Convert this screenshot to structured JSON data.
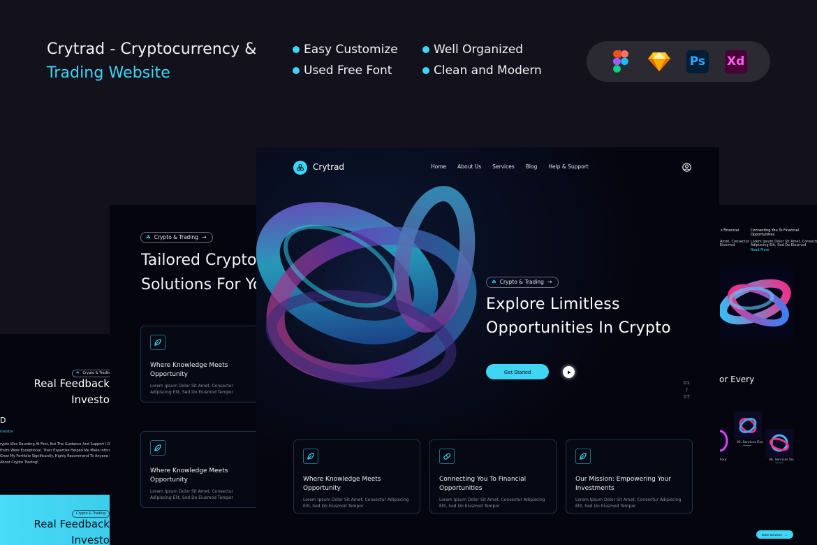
{
  "promo": {
    "title_line1": "Crytrad - Cryptocurrency &",
    "title_line2": "Trading Website",
    "features": [
      "Easy Customize",
      "Well Organized",
      "Used Free Font",
      "Clean and Modern"
    ],
    "tools": [
      "figma",
      "sketch",
      "Ps",
      "Xd"
    ],
    "accent_color": "#3fd5f3"
  },
  "main": {
    "brand": "Crytrad",
    "nav": [
      "Home",
      "About Us",
      "Services",
      "Blog",
      "Help & Support"
    ],
    "tag": "Crypto & Trading",
    "hero_line1": "Explore Limitless",
    "hero_line2": "Opportunities In Crypto",
    "cta": "Get Started",
    "slide_current": "01",
    "slide_sep": "/",
    "slide_total": "07",
    "cards": [
      {
        "title": "Where Knowledge Meets Opportunity",
        "desc": "Lorem Ipsum Dolor Sit Amet, Consectur Adipiscing Elit, Sed Do Eiusmod Tempor",
        "icon": "leaf-icon"
      },
      {
        "title": "Connecting You To Financial Opportunities",
        "desc": "Lorem Ipsum Dolor Sit Amet, Consectur Adipiscing Elit, Sed Do Eiusmod Tempor",
        "icon": "capsule-icon"
      },
      {
        "title": "Our Mission: Empowering Your Investments",
        "desc": "Lorem Ipsum Dolor Sit Amet, Consectur Adipiscing Elit, Sed Do Eiusmod Tempor",
        "icon": "leaf-icon"
      }
    ]
  },
  "mid": {
    "tag": "Crypto & Trading",
    "title_line1": "Tailored Crypto",
    "title_line2": "Solutions For You",
    "cards": [
      {
        "title": "Where Knowledge Meets Opportunity",
        "desc": "Lorem Ipsum Dolor Sit Amet, Consectur Adipiscing Elit, Sed Do Eiusmod Tempor"
      },
      {
        "title": "Where Knowledge Meets Opportunity",
        "desc": "Lorem Ipsum Dolor Sit Amet, Consectur Adipiscing Elit, Sed Do Eiusmod Tempor"
      }
    ]
  },
  "left": {
    "tag": "Crypto & Trading",
    "title_line1": "Real Feedback",
    "title_line2": "Investo",
    "name": "D",
    "role": "nvestor",
    "quote": [
      "rypto Was Daunting At First, But The Guidance And Support I Receive",
      "tform Were Exceptional. Their Expertise Helped Me Make Informed",
      "Grow My Portfolio Significantly. Highly Recommend To Anyone Looki",
      "About Crypto Trading!"
    ],
    "tag2": "Crypto & Trading",
    "title2_line1": "Real Feedback",
    "title2_line2": "Investo"
  },
  "right": {
    "col1_title": "s Financial",
    "col1_desc1": "Amet, Consectur",
    "col1_desc2": "Eiusmod",
    "col2_title1": "Connecting You To Financial",
    "col2_title2": "Opportunities",
    "col2_desc1": "Lorem Ipsum Dolor Sit Amet, Consectur",
    "col2_desc2": "Adipiscing Elit, Sed Do Eiusmod",
    "read_more": "Read More",
    "heading": "or Every",
    "service4_label": "Four",
    "service5_label": "05. Services Five",
    "service6_label": "06. Services Six",
    "more_services": "More Services"
  }
}
